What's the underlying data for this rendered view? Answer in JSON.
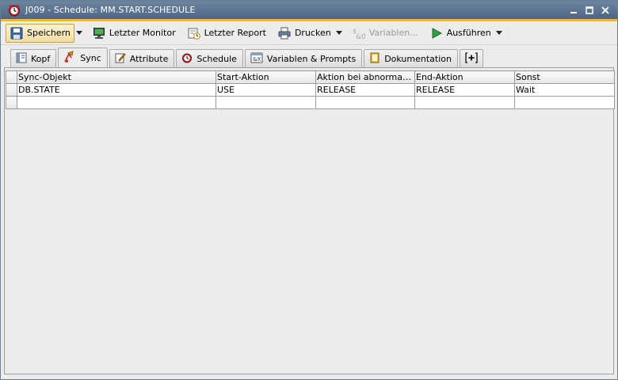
{
  "window": {
    "title": "J009 - Schedule: MM.START.SCHEDULE",
    "icon": "schedule-clock-icon",
    "accent_color": "#f2b63a",
    "titlebar_color": "#56708d"
  },
  "toolbar": {
    "save_label": "Speichern",
    "last_monitor_label": "Letzter Monitor",
    "last_report_label": "Letzter Report",
    "print_label": "Drucken",
    "variables_label": "Variablen...",
    "execute_label": "Ausführen"
  },
  "tabs": [
    {
      "label": "Kopf",
      "icon": "header-icon"
    },
    {
      "label": "Sync",
      "icon": "sync-icon"
    },
    {
      "label": "Attribute",
      "icon": "attribute-icon"
    },
    {
      "label": "Schedule",
      "icon": "schedule-icon"
    },
    {
      "label": "Variablen & Prompts",
      "icon": "variables-icon"
    },
    {
      "label": "Dokumentation",
      "icon": "documentation-icon"
    },
    {
      "label": "[+]",
      "icon": "add-tab-icon"
    }
  ],
  "selected_tab": "Sync",
  "table": {
    "columns": [
      "Sync-Objekt",
      "Start-Aktion",
      "Aktion bei abnormalen ...",
      "End-Aktion",
      "Sonst"
    ],
    "rows": [
      [
        "DB.STATE",
        "USE",
        "RELEASE",
        "RELEASE",
        "Wait"
      ],
      [
        "",
        "",
        "",
        "",
        ""
      ]
    ]
  }
}
